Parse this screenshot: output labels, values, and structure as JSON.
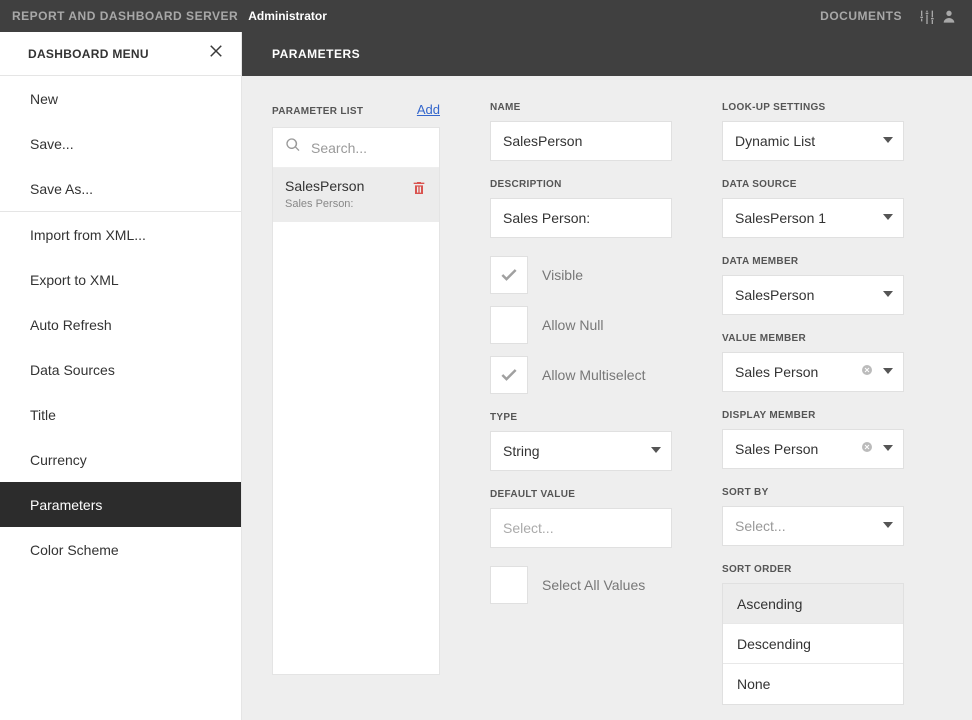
{
  "topbar": {
    "title": "REPORT AND DASHBOARD SERVER",
    "role": "Administrator",
    "documents": "DOCUMENTS"
  },
  "sidebar": {
    "title": "DASHBOARD MENU",
    "items": {
      "new": "New",
      "save": "Save...",
      "saveas": "Save As...",
      "importxml": "Import from XML...",
      "exportxml": "Export to XML",
      "autorefresh": "Auto Refresh",
      "datasources": "Data Sources",
      "title_item": "Title",
      "currency": "Currency",
      "parameters": "Parameters",
      "colorscheme": "Color Scheme"
    }
  },
  "content": {
    "heading": "PARAMETERS"
  },
  "paramlist": {
    "heading": "PARAMETER LIST",
    "add": "Add",
    "search_placeholder": "Search...",
    "items": [
      {
        "name": "SalesPerson",
        "desc": "Sales Person:"
      }
    ]
  },
  "form": {
    "name_label": "NAME",
    "name_value": "SalesPerson",
    "description_label": "DESCRIPTION",
    "description_value": "Sales Person:",
    "visible": "Visible",
    "allow_null": "Allow Null",
    "allow_multi": "Allow Multiselect",
    "type_label": "TYPE",
    "type_value": "String",
    "default_label": "DEFAULT VALUE",
    "default_placeholder": "Select...",
    "select_all": "Select All Values"
  },
  "lookup": {
    "settings_label": "LOOK-UP SETTINGS",
    "settings_value": "Dynamic List",
    "datasource_label": "DATA SOURCE",
    "datasource_value": "SalesPerson 1",
    "datamember_label": "DATA MEMBER",
    "datamember_value": "SalesPerson",
    "valuemember_label": "VALUE MEMBER",
    "valuemember_value": "Sales Person",
    "displaymember_label": "DISPLAY MEMBER",
    "displaymember_value": "Sales Person",
    "sortby_label": "SORT BY",
    "sortby_placeholder": "Select...",
    "sortorder_label": "SORT ORDER",
    "sortorder": {
      "asc": "Ascending",
      "desc": "Descending",
      "none": "None"
    }
  }
}
